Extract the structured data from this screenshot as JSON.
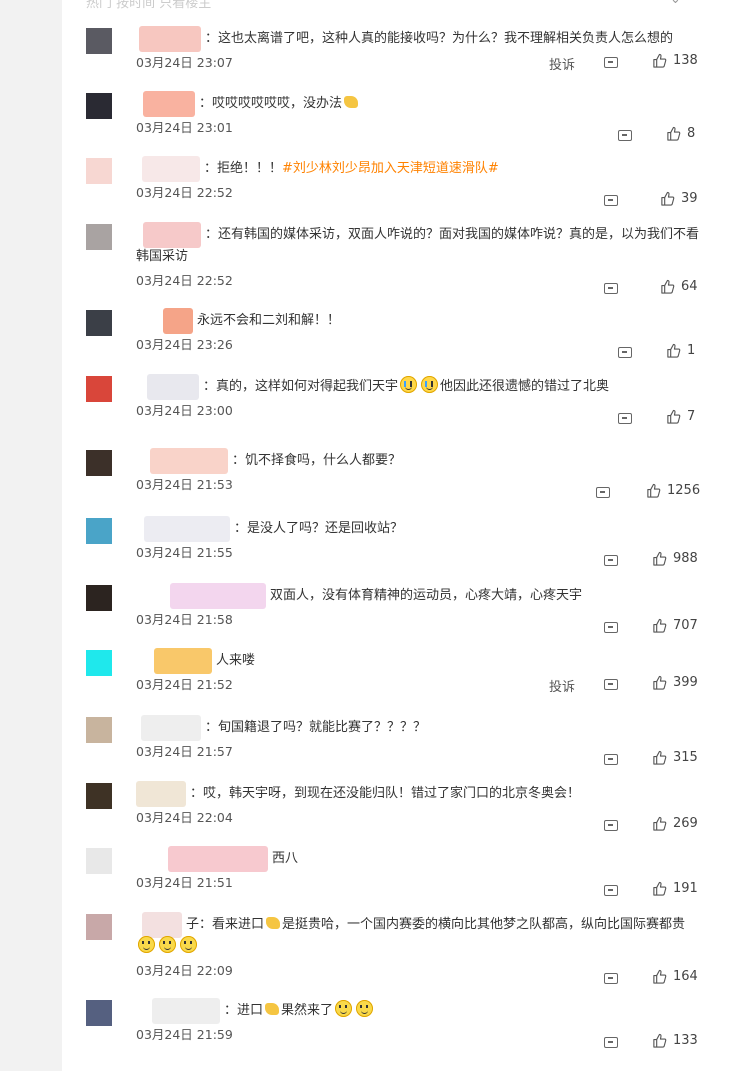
{
  "top_cut_text": "热门  按时间  只看楼主",
  "comments": [
    {
      "text": "：这也太离谱了吧，这种人真的能接收吗？为什么？我不理解相关负责人怎么想的",
      "time": "03月24日 23:07",
      "report": "投诉",
      "likes": "138",
      "avatar": "#5a5a62",
      "name_color": "#f7c7c0"
    },
    {
      "text": "：哎哎哎哎哎哎，没办法",
      "time": "03月24日 23:01",
      "likes": "8",
      "avatar": "#2a2a33",
      "name_color": "#f9b2a0",
      "emoji": "clap"
    },
    {
      "text": "：拒绝！！！",
      "topic": "#刘少林刘少昂加入天津短道速滑队#",
      "time": "03月24日 22:52",
      "likes": "39",
      "avatar": "#f7d7d2",
      "name_color": "#f7e8e8"
    },
    {
      "text": "：还有韩国的媒体采访，双面人咋说的？面对我国的媒体咋说？真的是，以为我们不看韩国采访",
      "time": "03月24日 22:52",
      "likes": "64",
      "avatar": "#a9a3a2",
      "name_color": "#f6c9c9"
    },
    {
      "text": "永远不会和二刘和解！！",
      "time": "03月24日 23:26",
      "likes": "1",
      "avatar": "#3b3f47",
      "name_color": "#f5a488"
    },
    {
      "text": "：真的，这样如何对得起我们天宇",
      "text2": "他因此还很遗憾的错过了北奥",
      "time": "03月24日 23:00",
      "likes": "7",
      "avatar": "#d9463a",
      "name_color": "#e8e8ee"
    },
    {
      "text": "：饥不择食吗，什么人都要？",
      "time": "03月24日 21:53",
      "likes": "1256",
      "avatar": "#3c3029",
      "name_color": "#f9d3c9"
    },
    {
      "text": "：是没人了吗？还是回收站？",
      "time": "03月24日 21:55",
      "likes": "988",
      "avatar": "#4aa4c8",
      "name_color": "#ececf2"
    },
    {
      "text": "双面人，没有体育精神的运动员，心疼大靖，心疼天宇",
      "time": "03月24日 21:58",
      "likes": "707",
      "avatar": "#2c2420",
      "name_color": "#f3d6ee"
    },
    {
      "text": "人来喽",
      "time": "03月24日 21:52",
      "report": "投诉",
      "likes": "399",
      "avatar": "#1fe8ec",
      "name_color": "#f9c86a"
    },
    {
      "text": "：旬国籍退了吗？就能比赛了？？？？",
      "time": "03月24日 21:57",
      "likes": "315",
      "avatar": "#c8b49e",
      "name_color": "#eeeeee"
    },
    {
      "text": "：哎，韩天宇呀，到现在还没能归队！错过了家门口的北京冬奥会！",
      "time": "03月24日 22:04",
      "likes": "269",
      "avatar": "#3e3225",
      "name_color": "#f0e6d6"
    },
    {
      "text": "西八",
      "time": "03月24日 21:51",
      "likes": "191",
      "avatar": "#e8e8e8",
      "name_color": "#f7c9cf"
    },
    {
      "text": "子：看来进口",
      "text2": "是挺贵哈，一个国内赛委的横向比其他梦之队都高，纵向比国际赛都贵",
      "time": "03月24日 22:09",
      "likes": "164",
      "avatar": "#c8a8a8",
      "name_color": "#f3e0e0"
    },
    {
      "text": "：进口",
      "text2": "果然来了",
      "time": "03月24日 21:59",
      "likes": "133",
      "avatar": "#556080",
      "name_color": "#eeeeee"
    }
  ]
}
